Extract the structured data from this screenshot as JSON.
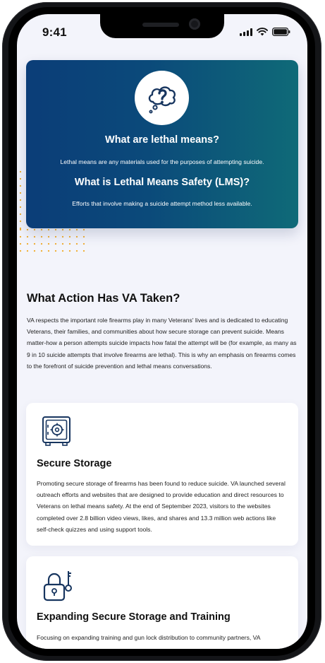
{
  "status_bar": {
    "time": "9:41"
  },
  "hero": {
    "icon": "thinking-cloud-question-icon",
    "heading1": "What are lethal means?",
    "text1": "Lethal means are any materials used for the purposes of attempting suicide.",
    "heading2": "What is Lethal Means Safety (LMS)?",
    "text2": "Efforts that involve making a suicide attempt method less available."
  },
  "action_section": {
    "title": "What Action Has VA Taken?",
    "body": "VA respects the important role firearms play in many Veterans' lives and is dedicated to educating Veterans, their families, and communities about how secure storage can prevent suicide. Means matter-how a person attempts suicide impacts how fatal the attempt will be (for example, as many as 9 in 10 suicide attempts that involve firearms are lethal). This is why an emphasis on firearms comes to the forefront of suicide prevention and lethal means conversations."
  },
  "cards": [
    {
      "icon": "safe-icon",
      "title": "Secure Storage",
      "body": "Promoting secure storage of firearms has been found to reduce suicide. VA launched several outreach efforts and websites that are designed to provide education and direct resources to Veterans on lethal means safety. At the end of September 2023, visitors to the websites completed over 2.8 billion video views, likes, and shares and 13.3 million web actions like self-check quizzes and using support tools."
    },
    {
      "icon": "lock-and-key-icon",
      "title": "Expanding Secure Storage and Training",
      "body": "Focusing on expanding training and gun lock distribution to community partners, VA"
    }
  ],
  "colors": {
    "brand_blue": "#0b3d78",
    "brand_teal": "#0f6a78",
    "accent_dots": "#f0b13a",
    "icon_navy": "#17355f"
  }
}
